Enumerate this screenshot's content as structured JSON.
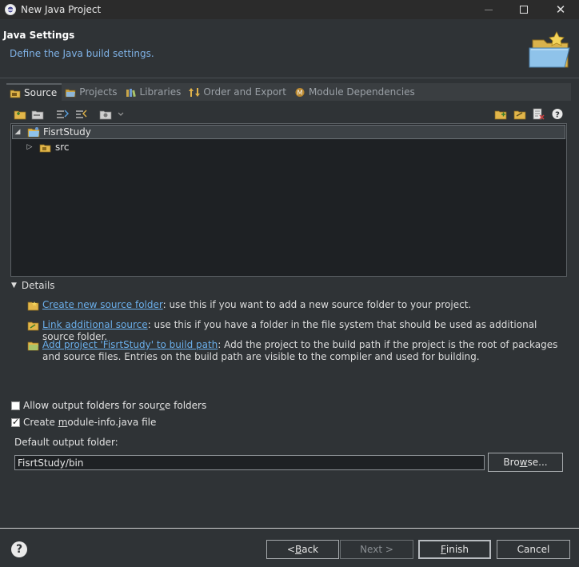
{
  "window": {
    "title": "New Java Project"
  },
  "header": {
    "title": "Java Settings",
    "description": "Define the Java build settings."
  },
  "tabs": [
    {
      "label": "Source",
      "active": true,
      "icon": "source-folder-icon"
    },
    {
      "label": "Projects",
      "active": false,
      "icon": "projects-icon"
    },
    {
      "label": "Libraries",
      "active": false,
      "icon": "libraries-icon"
    },
    {
      "label": "Order and Export",
      "active": false,
      "icon": "order-export-icon"
    },
    {
      "label": "Module Dependencies",
      "active": false,
      "icon": "module-icon"
    }
  ],
  "tree": {
    "project": {
      "label": "FisrtStudy",
      "expanded": true,
      "selected": true
    },
    "children": [
      {
        "label": "src",
        "expanded": false
      }
    ]
  },
  "details": {
    "label": "Details",
    "expanded": true,
    "items": [
      {
        "link": "Create new source folder",
        "text": ": use this if you want to add a new source folder to your project."
      },
      {
        "link": "Link additional source",
        "text": ": use this if you have a folder in the file system that should be used as additional source folder."
      },
      {
        "link": "Add project 'FisrtStudy' to build path",
        "text": ": Add the project to the build path if the project is the root of packages and source files. Entries on the build path are visible to the compiler and used for building."
      }
    ]
  },
  "options": {
    "allow_output_folders": {
      "label_before": "Allow output folders for sour",
      "mnemonic": "c",
      "label_after": "e folders",
      "checked": false
    },
    "create_module_info": {
      "label_before": "Create ",
      "mnemonic": "m",
      "label_after": "odule-info.java file",
      "checked": true
    }
  },
  "output": {
    "label": "Default output folder:",
    "value": "FisrtStudy/bin",
    "browse": {
      "before": "Bro",
      "mnemonic": "w",
      "after": "se..."
    }
  },
  "buttons": {
    "back": {
      "before": "< ",
      "mnemonic": "B",
      "after": "ack"
    },
    "next": "Next >",
    "finish": {
      "mnemonic": "F",
      "after": "inish"
    },
    "cancel": "Cancel"
  },
  "colors": {
    "background": "#2f3336",
    "link": "#6aaeea",
    "header_description": "#7fb2e6",
    "tree_background": "#1e2124"
  }
}
